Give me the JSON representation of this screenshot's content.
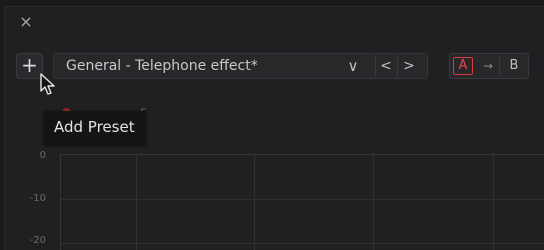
{
  "window": {
    "close_glyph": "×"
  },
  "toolbar": {
    "add_button": "+",
    "preset_label": "General - Telephone effect*",
    "dropdown_glyph": "∨",
    "prev_glyph": "<",
    "next_glyph": ">",
    "a_label": "A",
    "copy_arrow": "→",
    "b_label": "B"
  },
  "tooltip": {
    "text": "Add Preset"
  },
  "equalizer": {
    "label_fragment": "r"
  },
  "graph": {
    "y_ticks": [
      "0",
      "-10",
      "-20"
    ]
  },
  "colors": {
    "accent_red": "#e84444",
    "background": "#202022",
    "tooltip_bg": "#141415"
  },
  "icons": [
    "close-icon",
    "plus-icon",
    "chevron-down-icon",
    "chevron-left-icon",
    "chevron-right-icon",
    "arrow-right-icon",
    "mouse-cursor-icon"
  ]
}
